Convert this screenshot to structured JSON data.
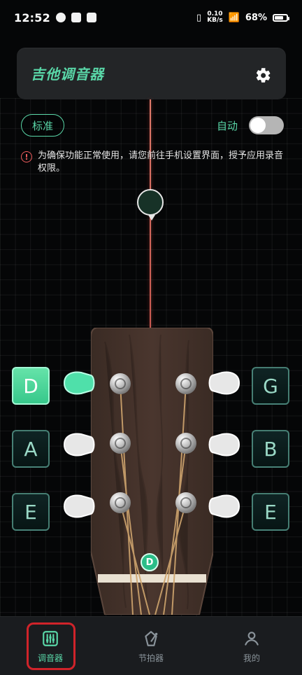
{
  "status_bar": {
    "time": "12:52",
    "net_speed_top": "0.10",
    "net_speed_bottom": "KB/s",
    "battery_percent": "68%",
    "battery_level": 0.68
  },
  "header": {
    "title": "吉他调音器",
    "settings_icon": "gear-icon"
  },
  "tuning": {
    "preset_label": "标准",
    "auto_label": "自动",
    "auto_on": false
  },
  "warning": {
    "icon": "warning-circle-icon",
    "text": "为确保功能正常使用，请您前往手机设置界面，授予应用录音权限。"
  },
  "strings": {
    "left": [
      {
        "note": "D",
        "active": true
      },
      {
        "note": "A",
        "active": false
      },
      {
        "note": "E",
        "active": false
      }
    ],
    "right": [
      {
        "note": "G",
        "active": false
      },
      {
        "note": "B",
        "active": false
      },
      {
        "note": "E",
        "active": false
      }
    ],
    "current_note_marker": "D"
  },
  "tabbar": {
    "items": [
      {
        "label": "调音器",
        "icon": "tuner-sliders-icon",
        "active": true
      },
      {
        "label": "节拍器",
        "icon": "metronome-icon",
        "active": false
      },
      {
        "label": "我的",
        "icon": "profile-icon",
        "active": false
      }
    ]
  },
  "colors": {
    "accent_green": "#59d6a7",
    "warning_red": "#ef5d5d",
    "highlight_red": "#d0232a"
  }
}
